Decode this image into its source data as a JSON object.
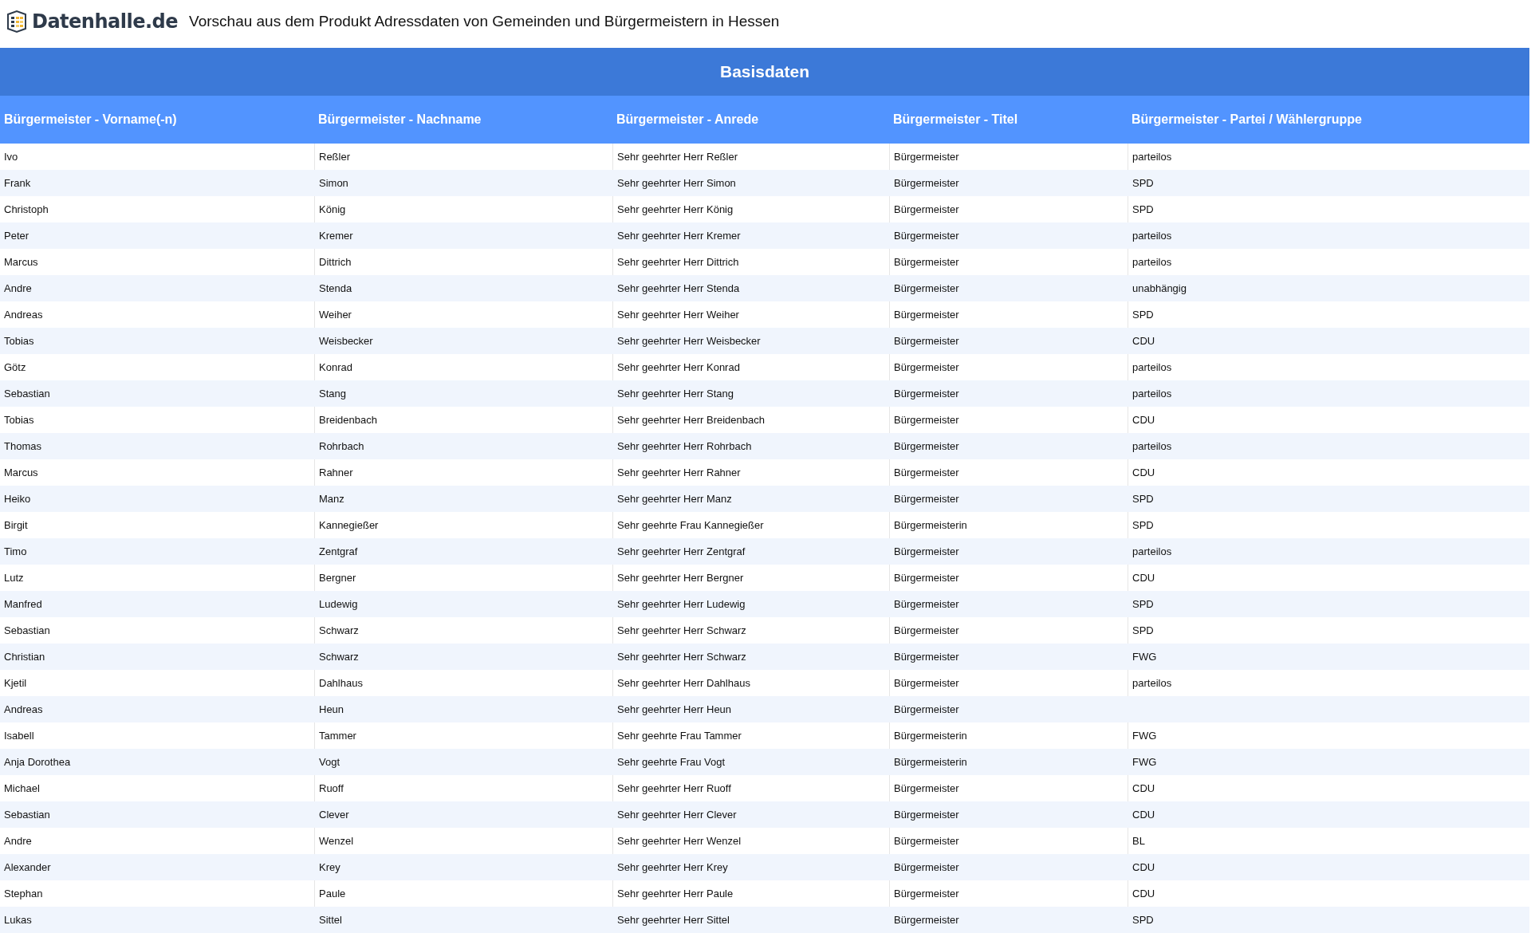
{
  "header": {
    "logo_text": "Datenhalle.de",
    "title": "Vorschau aus dem Produkt Adressdaten von Gemeinden und Bürgermeistern in Hessen"
  },
  "table": {
    "group_title": "Basisdaten",
    "columns": [
      "Bürgermeister - Vorname(-n)",
      "Bürgermeister - Nachname",
      "Bürgermeister - Anrede",
      "Bürgermeister - Titel",
      "Bürgermeister - Partei / Wählergruppe"
    ],
    "rows": [
      {
        "vorname": "Ivo",
        "nachname": "Reßler",
        "anrede": "Sehr geehrter Herr Reßler",
        "titel": "Bürgermeister",
        "partei": "parteilos"
      },
      {
        "vorname": "Frank",
        "nachname": "Simon",
        "anrede": "Sehr geehrter Herr Simon",
        "titel": "Bürgermeister",
        "partei": "SPD"
      },
      {
        "vorname": "Christoph",
        "nachname": "König",
        "anrede": "Sehr geehrter Herr König",
        "titel": "Bürgermeister",
        "partei": "SPD"
      },
      {
        "vorname": "Peter",
        "nachname": "Kremer",
        "anrede": "Sehr geehrter Herr Kremer",
        "titel": "Bürgermeister",
        "partei": "parteilos"
      },
      {
        "vorname": "Marcus",
        "nachname": "Dittrich",
        "anrede": "Sehr geehrter Herr Dittrich",
        "titel": "Bürgermeister",
        "partei": "parteilos"
      },
      {
        "vorname": "Andre",
        "nachname": "Stenda",
        "anrede": "Sehr geehrter Herr Stenda",
        "titel": "Bürgermeister",
        "partei": "unabhängig"
      },
      {
        "vorname": "Andreas",
        "nachname": "Weiher",
        "anrede": "Sehr geehrter Herr Weiher",
        "titel": "Bürgermeister",
        "partei": "SPD"
      },
      {
        "vorname": "Tobias",
        "nachname": "Weisbecker",
        "anrede": "Sehr geehrter Herr Weisbecker",
        "titel": "Bürgermeister",
        "partei": "CDU"
      },
      {
        "vorname": "Götz",
        "nachname": "Konrad",
        "anrede": "Sehr geehrter Herr Konrad",
        "titel": "Bürgermeister",
        "partei": "parteilos"
      },
      {
        "vorname": "Sebastian",
        "nachname": "Stang",
        "anrede": "Sehr geehrter Herr Stang",
        "titel": "Bürgermeister",
        "partei": "parteilos"
      },
      {
        "vorname": "Tobias",
        "nachname": "Breidenbach",
        "anrede": "Sehr geehrter Herr Breidenbach",
        "titel": "Bürgermeister",
        "partei": "CDU"
      },
      {
        "vorname": "Thomas",
        "nachname": "Rohrbach",
        "anrede": "Sehr geehrter Herr Rohrbach",
        "titel": "Bürgermeister",
        "partei": "parteilos"
      },
      {
        "vorname": "Marcus",
        "nachname": "Rahner",
        "anrede": "Sehr geehrter Herr Rahner",
        "titel": "Bürgermeister",
        "partei": "CDU"
      },
      {
        "vorname": "Heiko",
        "nachname": "Manz",
        "anrede": "Sehr geehrter Herr Manz",
        "titel": "Bürgermeister",
        "partei": "SPD"
      },
      {
        "vorname": "Birgit",
        "nachname": "Kannegießer",
        "anrede": "Sehr geehrte Frau Kannegießer",
        "titel": "Bürgermeisterin",
        "partei": "SPD"
      },
      {
        "vorname": "Timo",
        "nachname": "Zentgraf",
        "anrede": "Sehr geehrter Herr Zentgraf",
        "titel": "Bürgermeister",
        "partei": "parteilos"
      },
      {
        "vorname": "Lutz",
        "nachname": "Bergner",
        "anrede": "Sehr geehrter Herr Bergner",
        "titel": "Bürgermeister",
        "partei": "CDU"
      },
      {
        "vorname": "Manfred",
        "nachname": "Ludewig",
        "anrede": "Sehr geehrter Herr Ludewig",
        "titel": "Bürgermeister",
        "partei": "SPD"
      },
      {
        "vorname": "Sebastian",
        "nachname": "Schwarz",
        "anrede": "Sehr geehrter Herr Schwarz",
        "titel": "Bürgermeister",
        "partei": "SPD"
      },
      {
        "vorname": "Christian",
        "nachname": "Schwarz",
        "anrede": "Sehr geehrter Herr Schwarz",
        "titel": "Bürgermeister",
        "partei": "FWG"
      },
      {
        "vorname": "Kjetil",
        "nachname": "Dahlhaus",
        "anrede": "Sehr geehrter Herr Dahlhaus",
        "titel": "Bürgermeister",
        "partei": "parteilos"
      },
      {
        "vorname": "Andreas",
        "nachname": "Heun",
        "anrede": "Sehr geehrter Herr Heun",
        "titel": "Bürgermeister"
      },
      {
        "vorname": "Isabell",
        "nachname": "Tammer",
        "anrede": "Sehr geehrte Frau Tammer",
        "titel": "Bürgermeisterin",
        "partei": "FWG"
      },
      {
        "vorname": "Anja Dorothea",
        "nachname": "Vogt",
        "anrede": "Sehr geehrte Frau Vogt",
        "titel": "Bürgermeisterin",
        "partei": "FWG"
      },
      {
        "vorname": "Michael",
        "nachname": "Ruoff",
        "anrede": "Sehr geehrter Herr Ruoff",
        "titel": "Bürgermeister",
        "partei": "CDU"
      },
      {
        "vorname": "Sebastian",
        "nachname": "Clever",
        "anrede": "Sehr geehrter Herr Clever",
        "titel": "Bürgermeister",
        "partei": "CDU"
      },
      {
        "vorname": "Andre",
        "nachname": "Wenzel",
        "anrede": "Sehr geehrter Herr Wenzel",
        "titel": "Bürgermeister",
        "partei": "BL"
      },
      {
        "vorname": "Alexander",
        "nachname": "Krey",
        "anrede": "Sehr geehrter Herr Krey",
        "titel": "Bürgermeister",
        "partei": "CDU"
      },
      {
        "vorname": "Stephan",
        "nachname": "Paule",
        "anrede": "Sehr geehrter Herr Paule",
        "titel": "Bürgermeister",
        "partei": "CDU"
      },
      {
        "vorname": "Lukas",
        "nachname": "Sittel",
        "anrede": "Sehr geehrter Herr Sittel",
        "titel": "Bürgermeister",
        "partei": "SPD"
      }
    ]
  }
}
